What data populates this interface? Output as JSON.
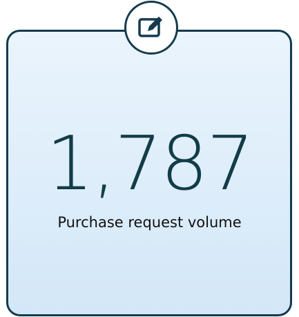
{
  "card": {
    "icon": "edit-icon",
    "value": "1,787",
    "label": "Purchase request volume"
  },
  "colors": {
    "border": "#143a4c",
    "value_text": "#123d48",
    "label_text": "#111111",
    "card_gradient_top": "#eaf4fc",
    "card_gradient_bottom": "#d3e7f8"
  }
}
